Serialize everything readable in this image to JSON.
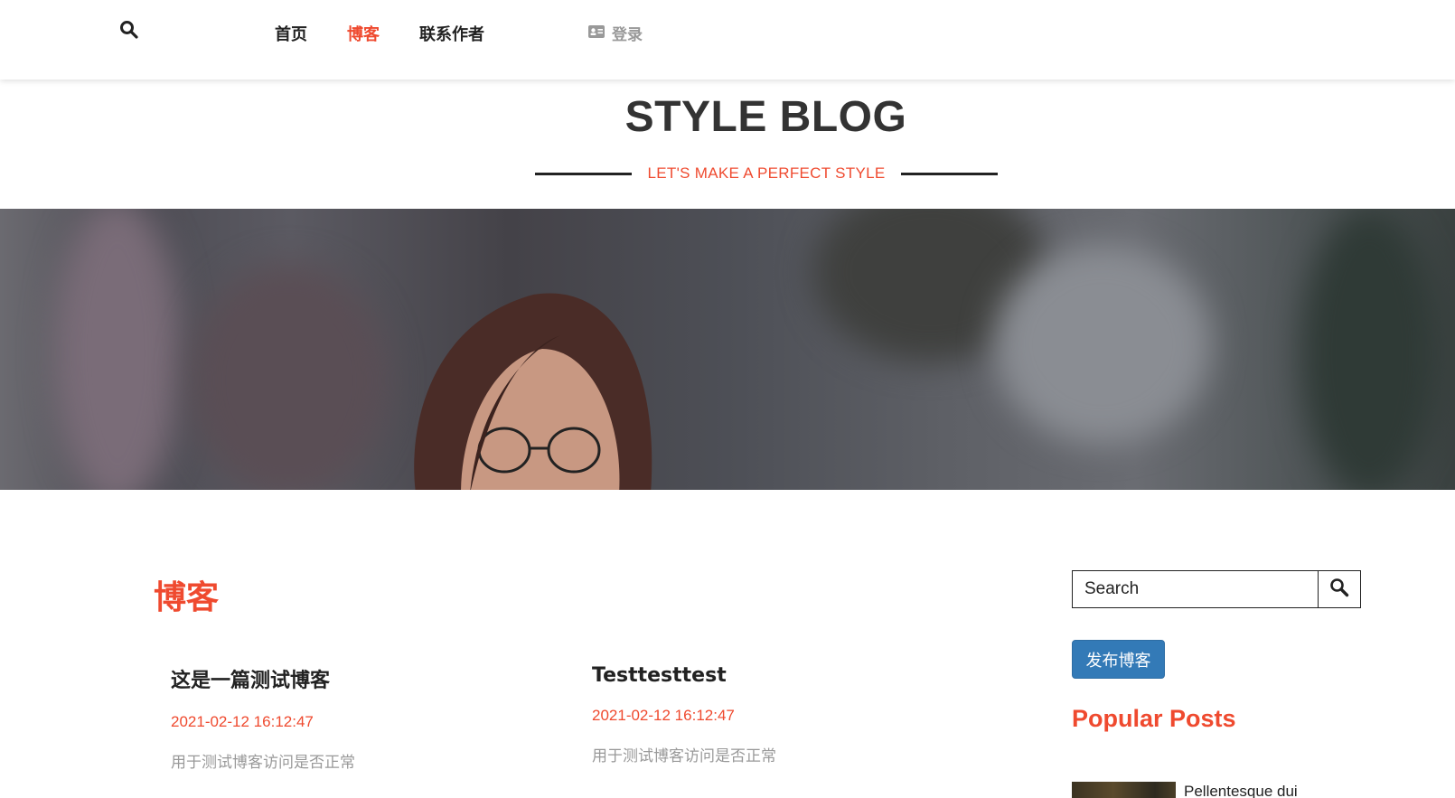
{
  "nav": {
    "search_icon": "search-icon",
    "items": [
      {
        "label": "首页",
        "active": false
      },
      {
        "label": "博客",
        "active": true
      },
      {
        "label": "联系作者",
        "active": false
      }
    ],
    "login_label": "登录",
    "login_icon": "id-card-icon"
  },
  "header": {
    "brand": "STYLE BLOG",
    "tagline": "LET'S MAKE A PERFECT STYLE"
  },
  "main": {
    "section_title": "博客",
    "posts": [
      {
        "title": "这是一篇测试博客",
        "date": "2021-02-12 16:12:47",
        "excerpt": "用于测试博客访问是否正常"
      },
      {
        "title": "Testtesttest",
        "date": "2021-02-12 16:12:47",
        "excerpt": "用于测试博客访问是否正常"
      }
    ]
  },
  "sidebar": {
    "search_placeholder": "Search",
    "publish_label": "发布博客",
    "popular_title": "Popular Posts",
    "popular_items": [
      {
        "title": "Pellentesque dui"
      }
    ]
  },
  "colors": {
    "accent": "#ef4a2f",
    "primary_button": "#337ab7"
  }
}
